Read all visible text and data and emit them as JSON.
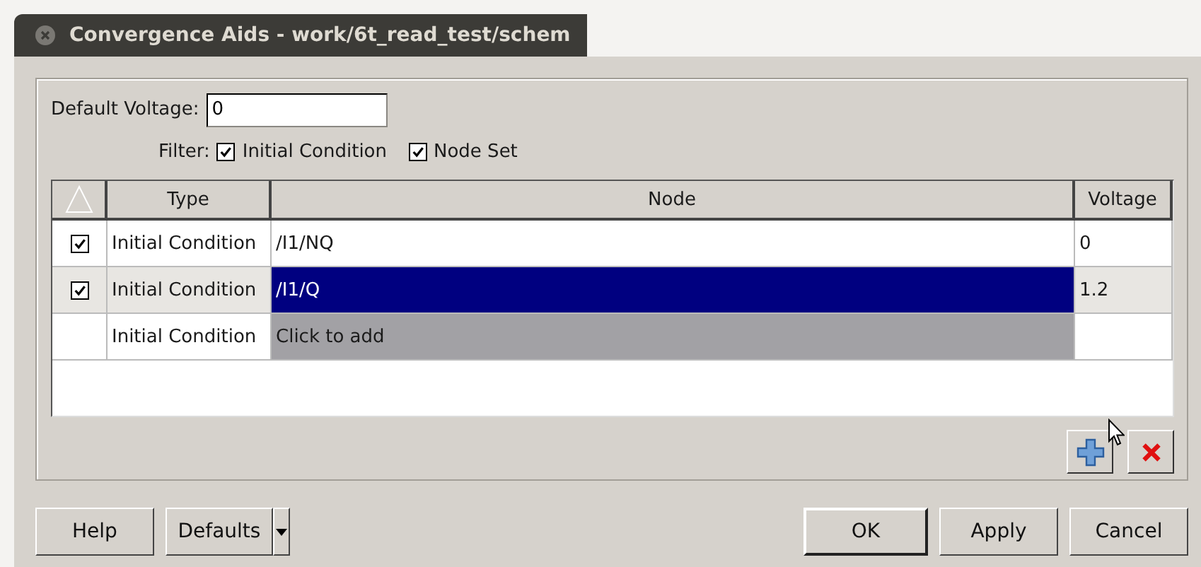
{
  "window": {
    "title": "Convergence Aids - work/6t_read_test/schem"
  },
  "default_voltage": {
    "label": "Default Voltage:",
    "value": "0"
  },
  "filter": {
    "label": "Filter:",
    "options": [
      {
        "label": "Initial Condition",
        "checked": true
      },
      {
        "label": "Node Set",
        "checked": true
      }
    ]
  },
  "table": {
    "columns": [
      "Type",
      "Node",
      "Voltage"
    ],
    "rows": [
      {
        "kind": "entry",
        "checked": true,
        "selected": false,
        "type": "Initial Condition",
        "node": "/I1/NQ",
        "voltage": "0"
      },
      {
        "kind": "entry",
        "checked": true,
        "selected": true,
        "type": "Initial Condition",
        "node": "/I1/Q",
        "voltage": "1.2"
      },
      {
        "kind": "add",
        "type": "Initial Condition",
        "node": "Click to add"
      }
    ]
  },
  "buttons_left": [
    "Help",
    "Defaults"
  ],
  "buttons_right": [
    "OK",
    "Apply",
    "Cancel"
  ]
}
